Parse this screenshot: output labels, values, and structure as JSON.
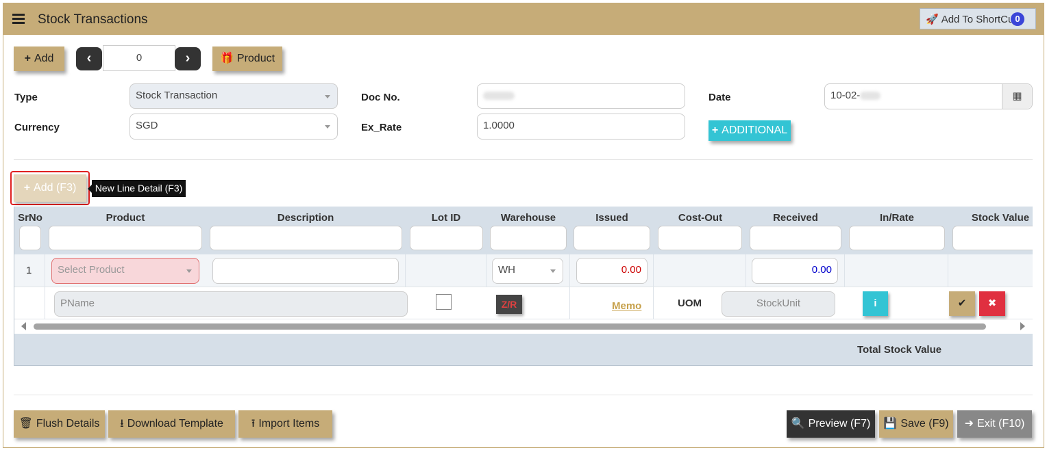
{
  "header": {
    "title": "Stock Transactions",
    "shortcut_label": "Add To ShortCut",
    "shortcut_count": "0"
  },
  "toolbar": {
    "add_label": "Add",
    "counter_value": "0",
    "product_label": "Product"
  },
  "form": {
    "type_label": "Type",
    "type_value": "Stock Transaction",
    "currency_label": "Currency",
    "currency_value": "SGD",
    "docno_label": "Doc No.",
    "exrate_label": "Ex_Rate",
    "exrate_value": "1.0000",
    "date_label": "Date",
    "date_value": "10-02-",
    "additional_label": "ADDITIONAL"
  },
  "line": {
    "add_label": "Add (F3)",
    "tooltip": "New Line Detail (F3)"
  },
  "grid": {
    "columns": [
      "SrNo",
      "Product",
      "Description",
      "Lot ID",
      "Warehouse",
      "Issued",
      "Cost-Out",
      "Received",
      "In/Rate",
      "Stock Value"
    ],
    "row": {
      "srno": "1",
      "product_placeholder": "Select Product",
      "warehouse": "WH",
      "issued": "0.00",
      "received": "0.00",
      "pname_placeholder": "PName",
      "zr_label": "Z/R",
      "memo_label": "Memo",
      "uom_label": "UOM",
      "stockunit_placeholder": "StockUnit"
    },
    "total_label": "Total Stock Value"
  },
  "bottom": {
    "flush_label": "Flush Details",
    "download_label": "Download Template",
    "import_label": "Import Items",
    "preview_label": "Preview (F7)",
    "save_label": "Save (F9)",
    "exit_label": "Exit (F10)"
  },
  "colors": {
    "accent": "#c6ac78",
    "cyan": "#33c4d4",
    "danger": "#e03040",
    "issued_text": "#cc0000",
    "received_text": "#0000cc"
  }
}
